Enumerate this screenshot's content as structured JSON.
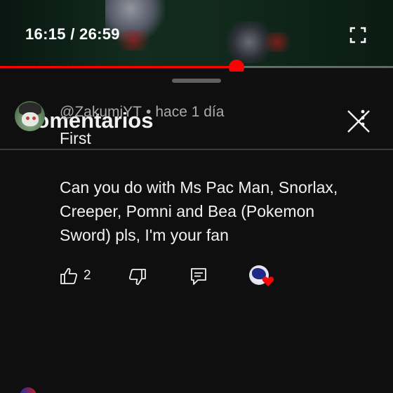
{
  "player": {
    "current_time": "16:15",
    "separator": " / ",
    "duration": "26:59",
    "progress_fraction": 0.602
  },
  "comments_panel": {
    "title": "Comentarios"
  },
  "comment": {
    "author": "@ZakumiYT",
    "dot": "•",
    "time_ago": "hace 1 día",
    "line1": "First",
    "line2": "Can you do with Ms Pac Man, Snorlax, Creeper, Pomni and Bea (Pokemon Sword) pls, I'm your fan",
    "like_count": "2",
    "creator_heart": true
  },
  "colors": {
    "accent": "#ff0000",
    "background": "#0f0f0f",
    "secondary_text": "#aaaaaa"
  },
  "icons": [
    "fullscreen-icon",
    "close-icon",
    "more-vert-icon",
    "thumb-up-icon",
    "thumb-down-icon",
    "reply-icon",
    "heart-icon"
  ]
}
